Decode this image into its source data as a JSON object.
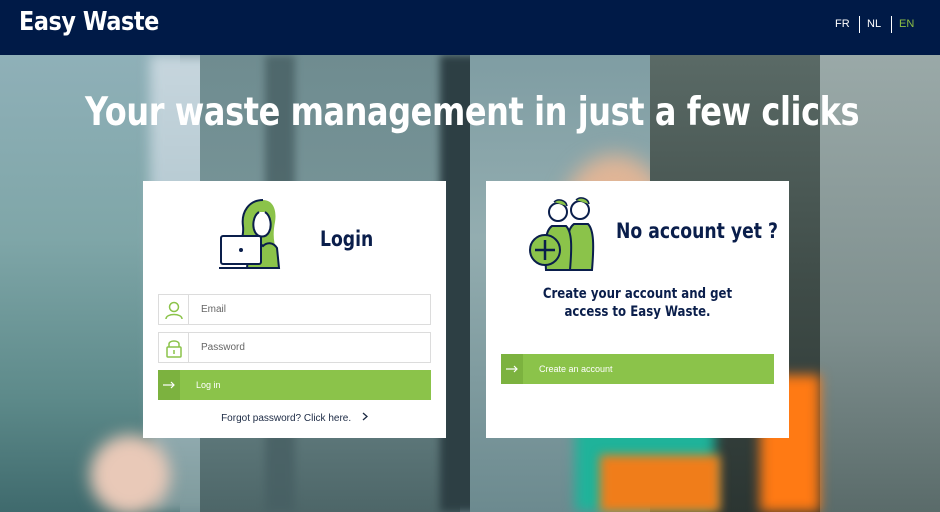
{
  "header": {
    "brand": "Easy Waste",
    "languages": [
      {
        "label": "FR",
        "active": false
      },
      {
        "label": "NL",
        "active": false
      },
      {
        "label": "EN",
        "active": true
      }
    ]
  },
  "hero": {
    "title": "Your waste management in just a few clicks"
  },
  "login": {
    "heading": "Login",
    "email_placeholder": "Email",
    "password_placeholder": "Password",
    "submit_label": "Log in",
    "forgot_label": "Forgot password? Click here."
  },
  "signup": {
    "heading": "No account yet ?",
    "description": "Create your account and get access to Easy Waste.",
    "button_label": "Create an account"
  },
  "colors": {
    "header_bg": "#001a47",
    "accent_green": "#8bc34a",
    "heading_navy": "#0a1e4b",
    "active_lang": "#8bbd44"
  },
  "icons": [
    "user-icon",
    "lock-icon",
    "arrow-right-icon",
    "chevron-right-icon",
    "login-illustration",
    "people-add-illustration"
  ]
}
